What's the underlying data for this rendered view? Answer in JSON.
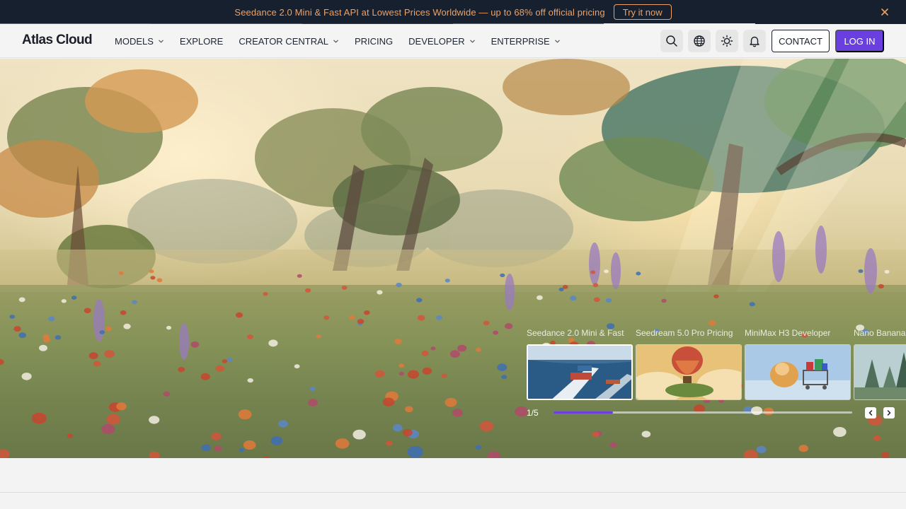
{
  "announcement": {
    "text": "Seedance 2.0 Mini & Fast API at Lowest Prices Worldwide — up to 68% off official pricing",
    "button_label": "Try it now",
    "colors": {
      "background": "#17202f",
      "accent": "#f0a060"
    }
  },
  "nav": {
    "logo": "Atlas Cloud",
    "items": [
      {
        "label": "MODELS",
        "has_dropdown": true
      },
      {
        "label": "EXPLORE",
        "has_dropdown": false
      },
      {
        "label": "CREATOR CENTRAL",
        "has_dropdown": true
      },
      {
        "label": "PRICING",
        "has_dropdown": false
      },
      {
        "label": "DEVELOPER",
        "has_dropdown": true
      },
      {
        "label": "ENTERPRISE",
        "has_dropdown": true
      }
    ],
    "icons": [
      "search-icon",
      "globe-icon",
      "sun-icon",
      "bell-icon"
    ],
    "contact_label": "CONTACT",
    "login_label": "LOG IN",
    "colors": {
      "primary": "#6a3fe0"
    }
  },
  "carousel": {
    "slides": [
      {
        "label": "Seedance 2.0 Mini & Fast",
        "thumbnail": "container-ship-thumbnail"
      },
      {
        "label": "Seedream 5.0 Pro Pricing",
        "thumbnail": "hot-air-balloon-thumbnail"
      },
      {
        "label": "MiniMax H3 Developer",
        "thumbnail": "hamster-cart-thumbnail"
      },
      {
        "label": "Nano Banana",
        "thumbnail": "misty-forest-thumbnail"
      }
    ],
    "current": 1,
    "total": 5,
    "counter": "1/5",
    "progress": 0.2
  }
}
